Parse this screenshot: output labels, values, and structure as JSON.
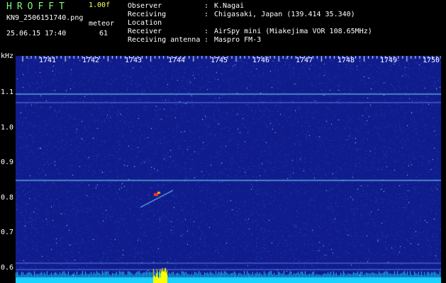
{
  "header": {
    "brand": "HROFFT",
    "version": "1.00f",
    "filename": "KN9_2506151740.png",
    "meteor_label": "meteor",
    "timestamp": "25.06.15 17:40",
    "meteor_count": "61"
  },
  "info": [
    {
      "key": "Observer",
      "value": "K.Nagai"
    },
    {
      "key": "Receiving Location",
      "value": "Chigasaki, Japan (139.414 35.340)"
    },
    {
      "key": "Receiver",
      "value": "AirSpy mini (Miakejima VOR 108.65MHz)"
    },
    {
      "key": "Receiving antenna",
      "value": "Maspro FM-3"
    }
  ],
  "spectrogram": {
    "unit": "kHz",
    "y_ticks": [
      "1.1",
      "1.0",
      "0.9",
      "0.8",
      "0.7",
      "0.6"
    ],
    "x_ticks": [
      "1741",
      "1742",
      "1743",
      "1744",
      "1745",
      "1746",
      "1747",
      "1748",
      "1749",
      "1750"
    ],
    "colors": {
      "background": "#101c8c",
      "noise": "#2a4cd6",
      "signal": "#7fe6ff",
      "bar": "#19d2ff",
      "burst": "#ffff00"
    }
  }
}
